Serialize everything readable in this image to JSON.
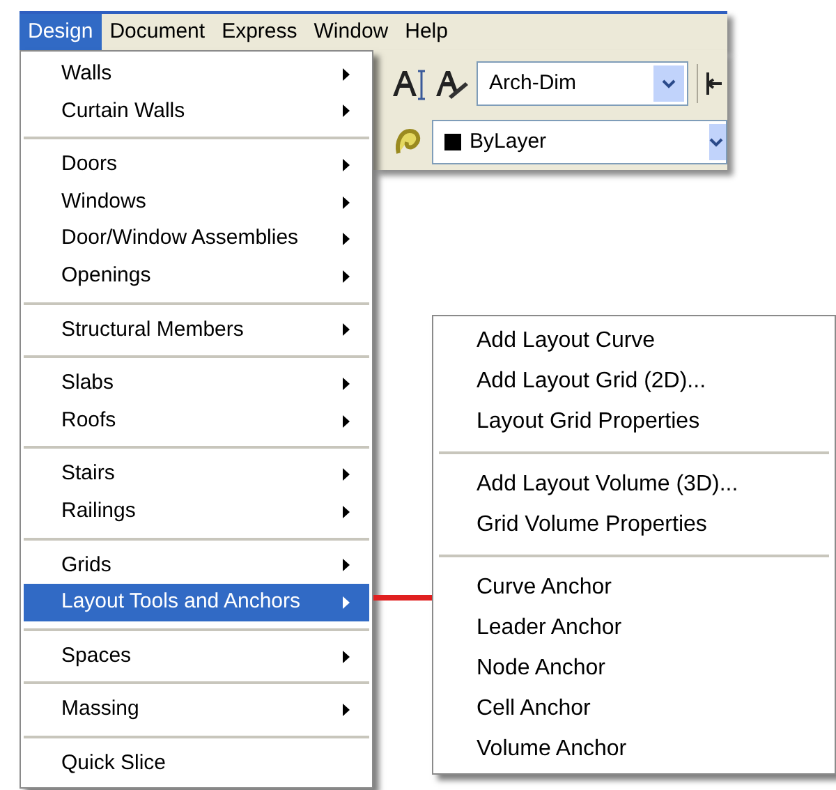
{
  "menubar": [
    {
      "label": "Design",
      "selected": true
    },
    {
      "label": "Document",
      "selected": false
    },
    {
      "label": "Express",
      "selected": false
    },
    {
      "label": "Window",
      "selected": false
    },
    {
      "label": "Help",
      "selected": false
    }
  ],
  "toolbar": {
    "style_dropdown": "Arch-Dim",
    "layer_dropdown": "ByLayer"
  },
  "menu": {
    "groups": [
      {
        "items": [
          {
            "label": "Walls",
            "submenu": true,
            "selected": false
          },
          {
            "label": "Curtain Walls",
            "submenu": true,
            "selected": false
          }
        ]
      },
      {
        "items": [
          {
            "label": "Doors",
            "submenu": true,
            "selected": false
          },
          {
            "label": "Windows",
            "submenu": true,
            "selected": false
          },
          {
            "label": "Door/Window Assemblies",
            "submenu": true,
            "selected": false
          },
          {
            "label": "Openings",
            "submenu": true,
            "selected": false
          }
        ]
      },
      {
        "items": [
          {
            "label": "Structural Members",
            "submenu": true,
            "selected": false
          }
        ]
      },
      {
        "items": [
          {
            "label": "Slabs",
            "submenu": true,
            "selected": false
          },
          {
            "label": "Roofs",
            "submenu": true,
            "selected": false
          }
        ]
      },
      {
        "items": [
          {
            "label": "Stairs",
            "submenu": true,
            "selected": false
          },
          {
            "label": "Railings",
            "submenu": true,
            "selected": false
          }
        ]
      },
      {
        "items": [
          {
            "label": "Grids",
            "submenu": true,
            "selected": false
          },
          {
            "label": "Layout Tools and Anchors",
            "submenu": true,
            "selected": true
          }
        ]
      },
      {
        "items": [
          {
            "label": "Spaces",
            "submenu": true,
            "selected": false
          }
        ]
      },
      {
        "items": [
          {
            "label": "Massing",
            "submenu": true,
            "selected": false
          }
        ]
      },
      {
        "items": [
          {
            "label": "Quick Slice",
            "submenu": false,
            "selected": false
          }
        ]
      }
    ]
  },
  "submenu": {
    "groups": [
      {
        "items": [
          "Add Layout Curve",
          "Add Layout Grid (2D)...",
          "Layout Grid Properties"
        ]
      },
      {
        "items": [
          "Add Layout Volume (3D)...",
          "Grid Volume Properties"
        ]
      },
      {
        "items": [
          "Curve Anchor",
          "Leader Anchor",
          "Node Anchor",
          "Cell Anchor",
          "Volume Anchor"
        ]
      }
    ]
  }
}
